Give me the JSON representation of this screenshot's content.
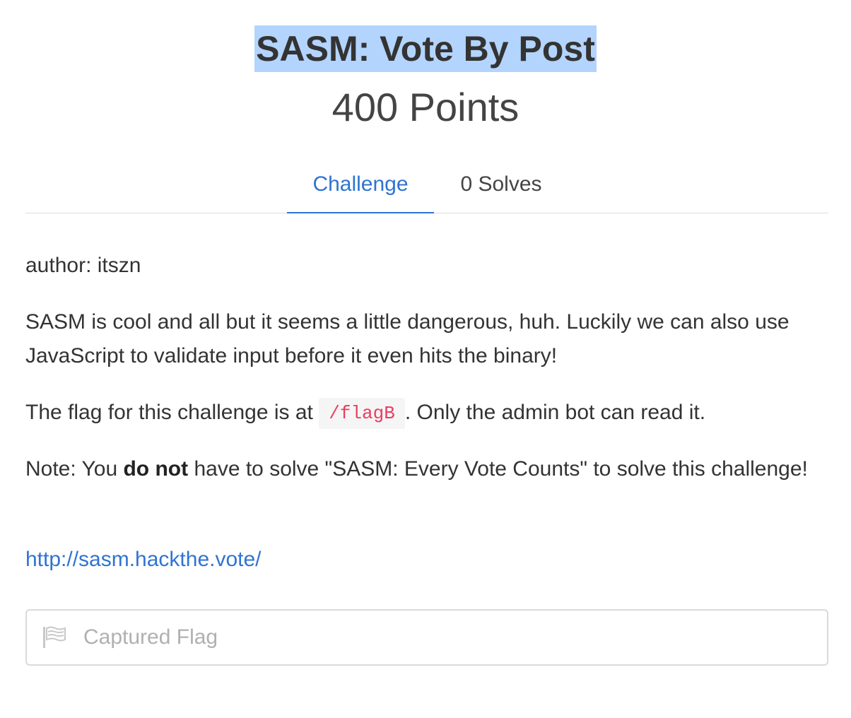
{
  "challenge": {
    "title": "SASM: Vote By Post",
    "points": "400 Points"
  },
  "tabs": [
    {
      "label": "Challenge",
      "active": true
    },
    {
      "label": "0 Solves",
      "active": false
    }
  ],
  "description": {
    "author": "author: itszn",
    "para1": "SASM is cool and all but it seems a little dangerous, huh. Luckily we can also use JavaScript to validate input before it even hits the binary!",
    "para2_before": "The flag for this challenge is at ",
    "para2_code": "/flagB",
    "para2_after": ". Only the admin bot can read it.",
    "para3_before": "Note: You ",
    "para3_bold": "do not",
    "para3_after": " have to solve \"SASM: Every Vote Counts\" to solve this challenge!",
    "link": "http://sasm.hackthe.vote/"
  },
  "flag_input": {
    "placeholder": "Captured Flag",
    "value": "",
    "icon": "flag-icon"
  },
  "colors": {
    "accent": "#2f74d0",
    "selection": "#b3d4fd",
    "code": "#e83e63"
  }
}
